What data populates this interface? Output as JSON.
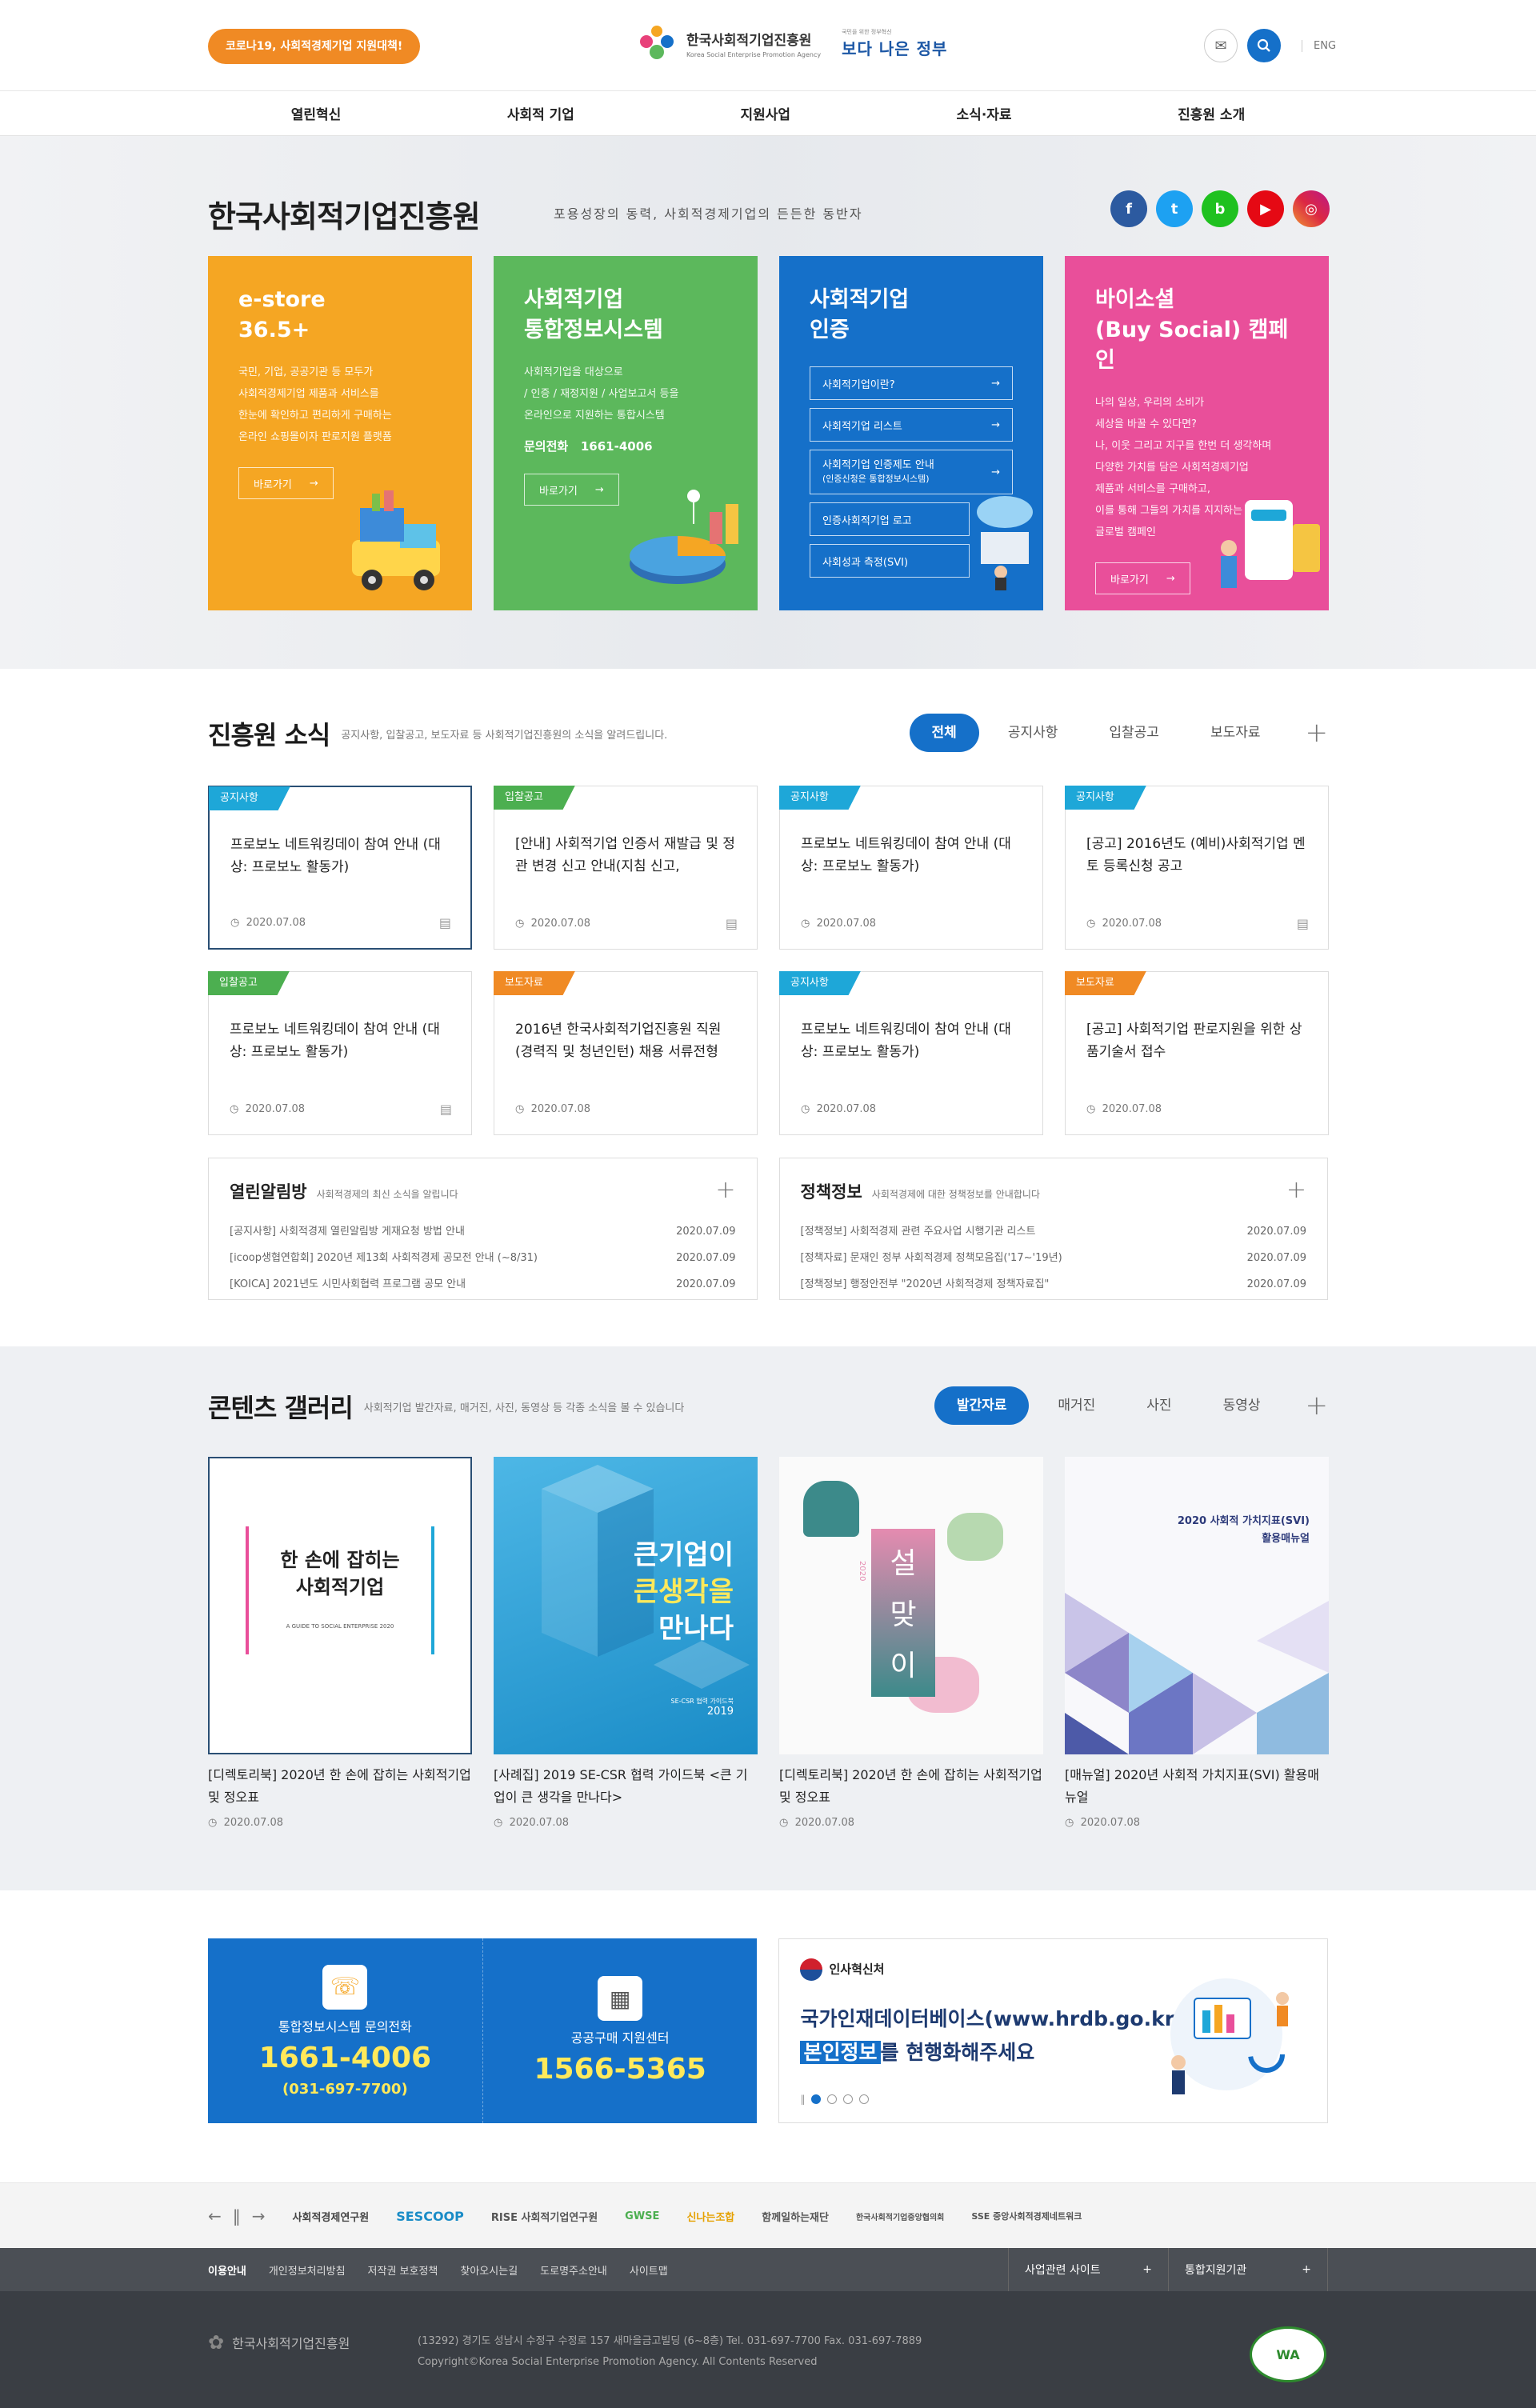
{
  "header": {
    "notice": "코로나19, 사회적경제기업 지원대책!",
    "org_name": "한국사회적기업진흥원",
    "org_name_en": "Korea Social Enterprise Promotion Agency",
    "gov_slogan": "보다 나은 정부",
    "gov_slogan_small": "국민을 위한 정부혁신",
    "lang": "ENG"
  },
  "nav": [
    "열린혁신",
    "사회적 기업",
    "지원사업",
    "소식·자료",
    "진흥원 소개"
  ],
  "hero": {
    "title": "한국사회적기업진흥원",
    "tagline": "포용성장의 동력, 사회적경제기업의 든든한 동반자",
    "cards": [
      {
        "title1": "e-store",
        "title2": "36.5+",
        "desc": [
          "국민, 기업, 공공기관 등 모두가",
          "사회적경제기업 제품과 서비스를",
          "한눈에 확인하고 편리하게 구매하는",
          "온라인 쇼핑몰이자 판로지원 플랫폼"
        ],
        "button": "바로가기"
      },
      {
        "title1": "사회적기업",
        "title2": "통합정보시스템",
        "desc": [
          "사회적기업을 대상으로",
          "/ 인증 / 재정지원 / 사업보고서 등을",
          "온라인으로 지원하는 통합시스템"
        ],
        "phone_label": "문의전화",
        "phone": "1661-4006",
        "button": "바로가기"
      },
      {
        "title1": "사회적기업",
        "title2": "인증",
        "links": [
          "사회적기업이란?",
          "사회적기업 리스트",
          "사회적기업 인증제도 안내",
          "인증사회적기업 로고",
          "사회성과 측정(SVI)"
        ],
        "link_sub": "(인증신청은 통합정보시스템)"
      },
      {
        "title1": "바이소셜",
        "title2": "(Buy Social) 캠페인",
        "desc": [
          "나의 일상, 우리의 소비가",
          "세상을 바꿀 수 있다면?",
          "나, 이웃 그리고 지구를 한번 더 생각하며",
          "다양한 가치를 담은 사회적경제기업",
          "제품과 서비스를 구매하고,",
          "이를 통해 그들의 가치를 지지하는",
          "글로벌 캠페인"
        ],
        "button": "바로가기"
      }
    ]
  },
  "news": {
    "title": "진흥원 소식",
    "desc": "공지사항, 입찰공고, 보도자료 등 사회적기업진흥원의 소식을 알려드립니다.",
    "tabs": [
      "전체",
      "공지사항",
      "입찰공고",
      "보도자료"
    ],
    "items": [
      {
        "badge": "공지사항",
        "title": "프로보노 네트워킹데이 참여 안내 (대상: 프로보노 활동가)",
        "date": "2020.07.08"
      },
      {
        "badge": "입찰공고",
        "title": "[안내] 사회적기업 인증서 재발급 및 정관 변경 신고 안내(지침 신고,",
        "date": "2020.07.08"
      },
      {
        "badge": "공지사항",
        "title": "프로보노 네트워킹데이 참여 안내 (대상: 프로보노 활동가)",
        "date": "2020.07.08"
      },
      {
        "badge": "공지사항",
        "title": "[공고] 2016년도 (예비)사회적기업 멘토 등록신청 공고",
        "date": "2020.07.08"
      },
      {
        "badge": "입찰공고",
        "title": "프로보노 네트워킹데이 참여 안내 (대상: 프로보노 활동가)",
        "date": "2020.07.08"
      },
      {
        "badge": "보도자료",
        "title": "2016년 한국사회적기업진흥원 직원(경력직 및 청년인턴) 채용 서류전형",
        "date": "2020.07.08"
      },
      {
        "badge": "공지사항",
        "title": "프로보노 네트워킹데이 참여 안내 (대상: 프로보노 활동가)",
        "date": "2020.07.08"
      },
      {
        "badge": "보도자료",
        "title": "[공고] 사회적기업 판로지원을 위한 상품기술서 접수",
        "date": "2020.07.08"
      }
    ]
  },
  "boards": [
    {
      "title": "열린알림방",
      "desc": "사회적경제의 최신 소식을 알립니다",
      "items": [
        {
          "text": "[공지사항] 사회적경제 열린알림방 게재요청 방법 안내",
          "date": "2020.07.09"
        },
        {
          "text": "[icoop생협연합회] 2020년 제13회 사회적경제 공모전 안내 (~8/31)",
          "date": "2020.07.09"
        },
        {
          "text": "[KOICA] 2021년도 시민사회협력 프로그램 공모 안내",
          "date": "2020.07.09"
        }
      ]
    },
    {
      "title": "정책정보",
      "desc": "사회적경제에 대한 정책정보를 안내합니다",
      "items": [
        {
          "text": "[정책정보] 사회적경제 관련 주요사업 시행기관 리스트",
          "date": "2020.07.09"
        },
        {
          "text": "[정책자료] 문재인 정부 사회적경제 정책모음집('17~'19년)",
          "date": "2020.07.09"
        },
        {
          "text": "[정책정보] 행정안전부 \"2020년 사회적경제 정책자료집\"",
          "date": "2020.07.09"
        }
      ]
    }
  ],
  "gallery": {
    "title": "콘텐츠 갤러리",
    "desc": "사회적기업 발간자료, 매거진, 사진, 동영상 등 각종 소식을 볼 수 있습니다",
    "tabs": [
      "발간자료",
      "매거진",
      "사진",
      "동영상"
    ],
    "items": [
      {
        "cover_title": "한 손에 잡히는",
        "cover_title2": "사회적기업",
        "cover_sub": "A GUIDE TO SOCIAL ENTERPRISE 2020",
        "caption": "[디렉토리북] 2020년 한 손에 잡히는 사회적기업 및 정오표",
        "date": "2020.07.08"
      },
      {
        "cover_title": "큰기업이",
        "cover_title2": "큰생각을",
        "cover_title3": "만나다",
        "cover_sub": "SE-CSR 협력 가이드북",
        "cover_year": "2019",
        "caption": "[사례집] 2019 SE-CSR 협력 가이드북 <큰 기업이 큰 생각을 만나다>",
        "date": "2020.07.08"
      },
      {
        "cover_chars": [
          "설",
          "맞",
          "이"
        ],
        "cover_year": "2020",
        "caption": "[디렉토리북] 2020년 한 손에 잡히는 사회적기업 및 정오표",
        "date": "2020.07.08"
      },
      {
        "cover_title": "2020 사회적 가치지표(SVI)",
        "cover_title2": "활용매뉴얼",
        "caption": "[매뉴얼] 2020년 사회적 가치지표(SVI) 활용매뉴얼",
        "date": "2020.07.08"
      }
    ]
  },
  "contact": {
    "left": {
      "label": "통합정보시스템 문의전화",
      "num": "1661-4006",
      "sub": "(031-697-7700)"
    },
    "right": {
      "label": "공공구매 지원센터",
      "num": "1566-5365"
    }
  },
  "promo": {
    "org": "인사혁신처",
    "line1": "국가인재데이터베이스(www.hrdb.go.kr)",
    "line2_hl": "본인정보",
    "line2": "를 현행화해주세요"
  },
  "partners": [
    "사회적경제연구원",
    "SESCOOP",
    "RISE 사회적기업연구원",
    "GWSE",
    "신나는조합",
    "함께일하는재단",
    "한국사회적기업중앙협의회",
    "SSE 중앙사회적경제네트워크"
  ],
  "footer": {
    "links": [
      "이용안내",
      "개인정보처리방침",
      "저작권 보호정책",
      "찾아오시는길",
      "도로명주소안내",
      "사이트맵"
    ],
    "select1": "사업관련 사이트",
    "select2": "통합지원기관",
    "org": "한국사회적기업진흥원",
    "addr": "(13292) 경기도 성남시 수정구 수정로 157 새마을금고빌딩 (6~8층) Tel. 031-697-7700 Fax. 031-697-7889",
    "copy": "Copyright©Korea Social Enterprise Promotion Agency. All Contents Reserved",
    "wa": "WA"
  },
  "colors": {
    "accent": "#1570c9",
    "orange": "#f5a623",
    "green": "#5cb85c",
    "pink": "#e94f9a",
    "badge_notice": "#1ea7d8",
    "badge_bid": "#4caf50",
    "badge_press": "#f08a24"
  }
}
